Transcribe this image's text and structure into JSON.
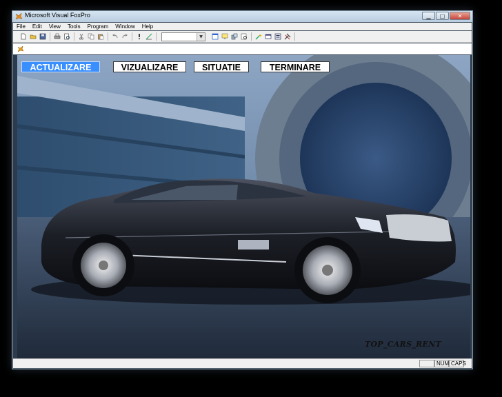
{
  "window": {
    "title": "Microsoft Visual FoxPro"
  },
  "menubar": {
    "items": [
      "File",
      "Edit",
      "View",
      "Tools",
      "Program",
      "Window",
      "Help"
    ]
  },
  "app_menu": {
    "buttons": [
      {
        "label": "ACTUALIZARE",
        "active": true
      },
      {
        "label": "VIZUALIZARE",
        "active": false
      },
      {
        "label": "SITUATIE",
        "active": false
      },
      {
        "label": "TERMINARE",
        "active": false
      }
    ]
  },
  "signature": "TOP_CARS_RENT",
  "statusbar": {
    "num": "NUM",
    "caps": "CAPS"
  },
  "colors": {
    "active_button": "#3a8fff",
    "window_chrome": "#f0f0f0"
  }
}
